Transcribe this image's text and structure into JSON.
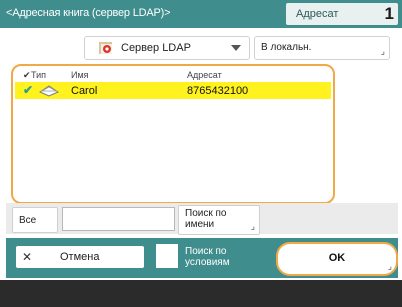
{
  "header": {
    "title": "<Адресная книга (сервер LDAP)>",
    "tab_label": "Адресат",
    "count": "1"
  },
  "toolbar": {
    "source_label": "Сервер LDAP",
    "local_label": "В локальн."
  },
  "list": {
    "columns": {
      "type": "Тип",
      "name": "Имя",
      "address": "Адресат"
    },
    "rows": [
      {
        "name": "Carol",
        "address": "8765432100",
        "selected": true
      }
    ]
  },
  "search": {
    "all_label": "Все",
    "input_value": "",
    "by_name_label": "Поиск по имени"
  },
  "actions": {
    "cancel_label": "Отмена",
    "condition_label": "Поиск по условиям",
    "ok_label": "OK"
  },
  "colors": {
    "teal": "#3f8d8d",
    "selection": "#fff21e",
    "focus_border": "#f0a944"
  },
  "icons": {
    "address_book": "address-book-icon",
    "check": "check-icon",
    "dropdown": "chevron-down-icon"
  }
}
